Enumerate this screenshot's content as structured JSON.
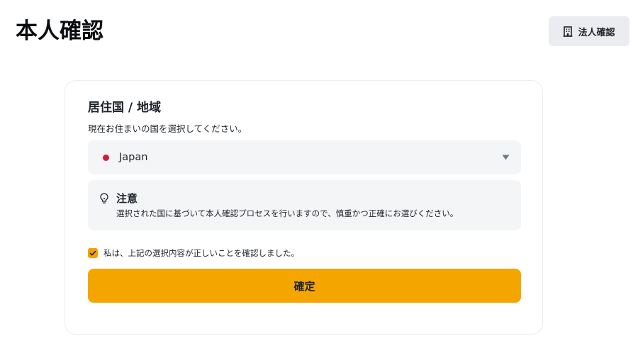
{
  "page": {
    "title": "本人確認"
  },
  "header": {
    "corporate_button_label": "法人確認",
    "corporate_button_icon": "building-icon"
  },
  "residence": {
    "title": "居住国 / 地域",
    "description": "現在お住まいの国を選択してください。",
    "selected_country": "Japan",
    "flag_color": "#cf1b3a",
    "dropdown_icon": "caret-down-icon"
  },
  "notice": {
    "icon": "lightbulb-icon",
    "title": "注意",
    "text": "選択された国に基づいて本人確認プロセスを行いますので、慎重かつ正確にお選びください。"
  },
  "confirmation": {
    "checked": true,
    "label": "私は、上記の選択内容が正しいことを確認しました。"
  },
  "submit": {
    "label": "確定"
  },
  "colors": {
    "accent": "#f5a500",
    "field_background": "#f4f5f7",
    "button_secondary": "#eaecef",
    "text": "#1e2329"
  }
}
